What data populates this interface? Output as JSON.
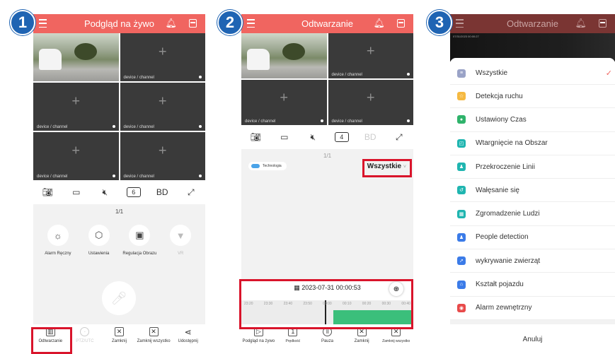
{
  "steps": [
    "1",
    "2",
    "3"
  ],
  "screen1": {
    "header_title": "Podgląd na żywo",
    "channel_label": "device / channel",
    "toolbar": {
      "quality": "BD",
      "split": "6"
    },
    "page_indicator": "1/1",
    "features": [
      {
        "label": "Alarm Ręczny",
        "icon": "siren-icon"
      },
      {
        "label": "Ustawienia",
        "icon": "settings-icon"
      },
      {
        "label": "Regulacja Obrazu",
        "icon": "image-adjust-icon"
      },
      {
        "label": "VR",
        "icon": "vr-icon"
      }
    ],
    "bottom": [
      {
        "label": "Odtwarzanie",
        "icon": "film-icon"
      },
      {
        "label": "PTZ/UTC",
        "icon": "ptz-icon"
      },
      {
        "label": "Zamknij",
        "icon": "close-box-icon"
      },
      {
        "label": "Zamknij wszystko",
        "icon": "close-all-icon"
      },
      {
        "label": "Udostępnij",
        "icon": "share-icon"
      }
    ]
  },
  "screen2": {
    "header_title": "Odtwarzanie",
    "channel_label": "device / channel",
    "toolbar": {
      "quality": "BD",
      "split": "4"
    },
    "page_indicator": "1/1",
    "device_chip": "Technologia",
    "filter_label": "Wszystkie",
    "timeline": {
      "date": "2023-07-31 00:00:53",
      "ticks": [
        "23:20",
        "23:30",
        "23:40",
        "23:50",
        "00:00",
        "00:10",
        "00:20",
        "00:30",
        "00:40"
      ]
    },
    "bottom": [
      {
        "label": "Podgląd na żywo",
        "icon": "play-box-icon"
      },
      {
        "label": "Prędkość",
        "icon": "speed-icon"
      },
      {
        "label": "Pauza",
        "icon": "pause-icon"
      },
      {
        "label": "Zamknij",
        "icon": "close-box-icon"
      },
      {
        "label": "Zamknij wszystko",
        "icon": "close-all-icon"
      }
    ]
  },
  "screen3": {
    "header_title": "Odtwarzanie",
    "timestamp": "07/31/2023 00:00:27",
    "options": [
      {
        "label": "Wszystkie",
        "color": "#9aa3c7",
        "selected": true
      },
      {
        "label": "Detekcja ruchu",
        "color": "#f5b941"
      },
      {
        "label": "Ustawiony Czas",
        "color": "#2fb36b"
      },
      {
        "label": "Wtargnięcie na Obszar",
        "color": "#1fb5b0"
      },
      {
        "label": "Przekroczenie Linii",
        "color": "#1fb5b0"
      },
      {
        "label": "Wałęsanie się",
        "color": "#1fb5b0"
      },
      {
        "label": "Zgromadzenie Ludzi",
        "color": "#1fb5b0"
      },
      {
        "label": "People detection",
        "color": "#3b7be8"
      },
      {
        "label": "wykrywanie zwierząt",
        "color": "#3b7be8"
      },
      {
        "label": "Kształt pojazdu",
        "color": "#3b7be8"
      },
      {
        "label": "Alarm zewnętrzny",
        "color": "#e84a4a"
      }
    ],
    "cancel_label": "Anuluj",
    "check_mark": "✓"
  }
}
